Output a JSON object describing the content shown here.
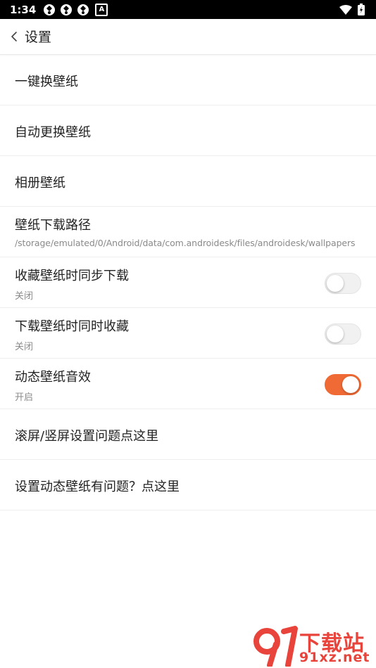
{
  "status_bar": {
    "time": "1:34",
    "notification_icons": [
      "sync-icon",
      "sync-icon",
      "sync-icon",
      "a-letter-icon"
    ],
    "a_letter": "A",
    "system_icons": [
      "wifi-icon",
      "battery-icon"
    ]
  },
  "app_bar": {
    "title": "设置"
  },
  "settings": [
    {
      "title": "一键换壁纸"
    },
    {
      "title": "自动更换壁纸"
    },
    {
      "title": "相册壁纸"
    },
    {
      "title": "壁纸下载路径",
      "subtitle": "/storage/emulated/0/Android/data/com.androidesk/files/androidesk/wallpapers"
    },
    {
      "title": "收藏壁纸时同步下载",
      "subtitle": "关闭",
      "toggle_on": false
    },
    {
      "title": "下载壁纸时同时收藏",
      "subtitle": "关闭",
      "toggle_on": false
    },
    {
      "title": "动态壁纸音效",
      "subtitle": "开启",
      "toggle_on": true
    },
    {
      "title": "滚屏/竖屏设置问题点这里"
    },
    {
      "title": "设置动态壁纸有问题？点这里"
    }
  ],
  "colors": {
    "accent": "#ef6a35",
    "watermark": "#e8443c"
  },
  "watermark": {
    "line1": "下载站",
    "line2": "91xz.net"
  }
}
